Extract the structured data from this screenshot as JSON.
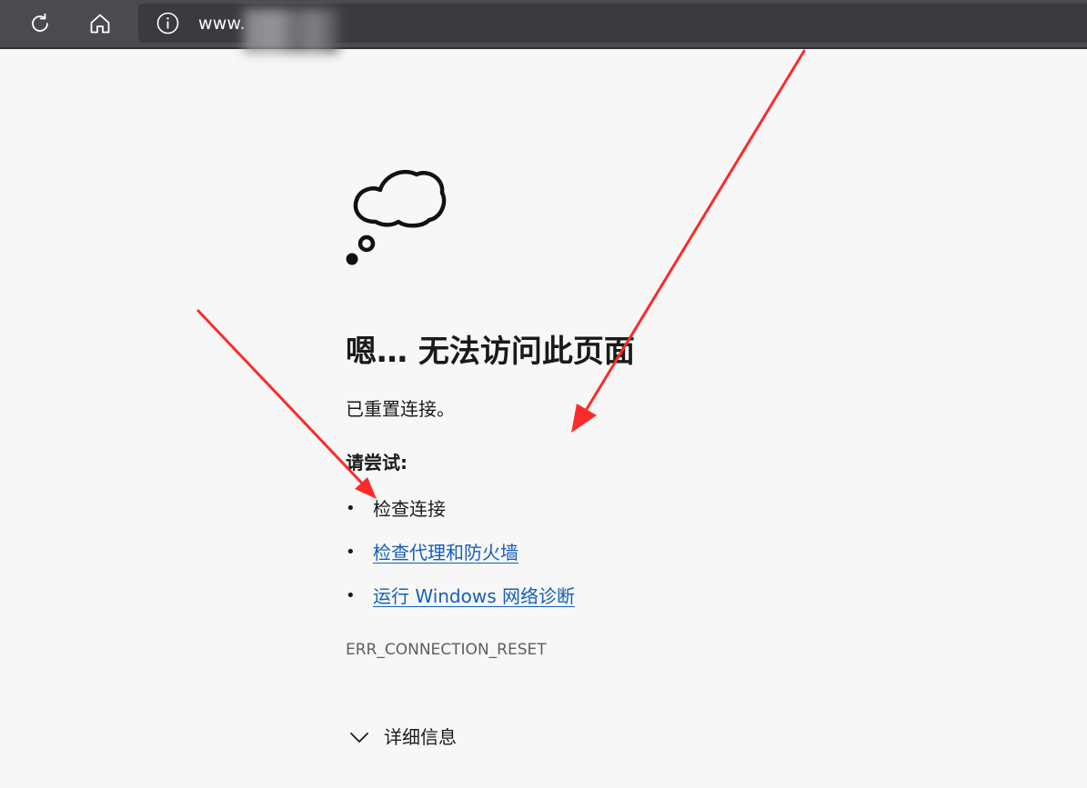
{
  "toolbar": {
    "refresh_icon": "refresh-icon",
    "home_icon": "home-icon",
    "info_icon": "info-icon",
    "url": "www."
  },
  "error_page": {
    "icon": "thought-cloud-icon",
    "title": "嗯… 无法访问此页面",
    "subtitle": "已重置连接。",
    "try_heading": "请尝试:",
    "suggestions": [
      {
        "text": "检查连接",
        "is_link": false
      },
      {
        "text": "检查代理和防火墙",
        "is_link": true
      },
      {
        "text": "运行 Windows 网络诊断",
        "is_link": true
      }
    ],
    "error_code": "ERR_CONNECTION_RESET",
    "details_toggle": "详细信息"
  },
  "colors": {
    "toolbar_bg": "#4b4b4f",
    "page_bg": "#f7f7f7",
    "link": "#1560b8",
    "annotation_arrow": "#ff2a2a"
  }
}
